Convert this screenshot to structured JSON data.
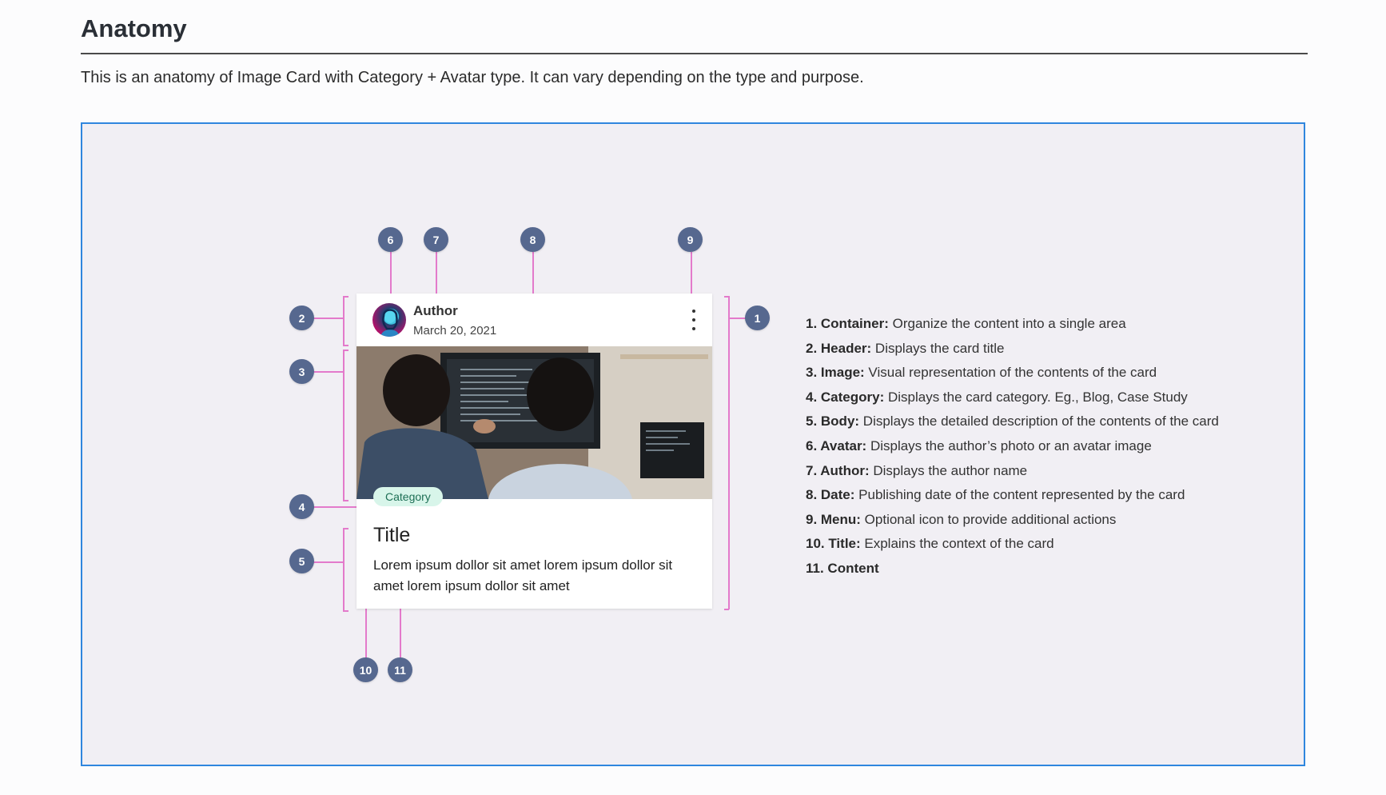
{
  "page": {
    "title": "Anatomy",
    "intro": "This is an anatomy of Image Card with Category + Avatar type. It can vary depending on the type and purpose."
  },
  "card": {
    "author": "Author",
    "date": "March 20, 2021",
    "category": "Category",
    "title": "Title",
    "body": "Lorem ipsum dollor sit amet lorem ipsum dollor sit amet lorem ipsum dollor sit amet"
  },
  "badges": [
    "1",
    "2",
    "3",
    "4",
    "5",
    "6",
    "7",
    "8",
    "9",
    "10",
    "11"
  ],
  "legend": [
    {
      "term": "1. Container:",
      "desc": " Organize the content into a single area"
    },
    {
      "term": "2. Header:",
      "desc": " Displays the card title"
    },
    {
      "term": "3. Image:",
      "desc": " Visual representation of the contents of the card"
    },
    {
      "term": "4. Category:",
      "desc": " Displays the card category. Eg., Blog, Case Study"
    },
    {
      "term": "5. Body:",
      "desc": " Displays the detailed description of the contents of the card"
    },
    {
      "term": "6. Avatar:",
      "desc": " Displays the author’s photo or an avatar image"
    },
    {
      "term": "7. Author:",
      "desc": " Displays the author name"
    },
    {
      "term": "8. Date:",
      "desc": " Publishing date of the content represented by the card"
    },
    {
      "term": "9. Menu:",
      "desc": " Optional icon to provide additional actions"
    },
    {
      "term": "10. Title:",
      "desc": " Explains the context of the card"
    },
    {
      "term": "11. Content",
      "desc": ""
    }
  ],
  "colors": {
    "frame_border": "#2f86de",
    "frame_bg": "#f1eff4",
    "badge": "#56688f",
    "connector": "#e37acb",
    "category_chip": "#d8f5ea"
  }
}
